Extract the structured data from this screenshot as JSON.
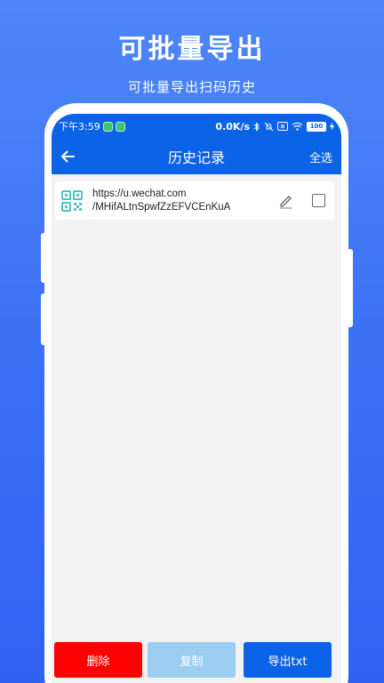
{
  "promo": {
    "title": "可批量导出",
    "subtitle": "可批量导出扫码历史"
  },
  "status_bar": {
    "time": "下午3:59",
    "network_speed": "0.0K/s",
    "battery": "100"
  },
  "app_bar": {
    "title": "历史记录",
    "select_all": "全选"
  },
  "history": {
    "items": [
      {
        "line1": "https://u.wechat.com",
        "line2": "/MHifALtnSpwfZzEFVCEnKuA",
        "checked": false
      }
    ]
  },
  "actions": {
    "delete": "删除",
    "copy": "复制",
    "export": "导出txt"
  },
  "colors": {
    "primary": "#0b63e8",
    "delete": "#ff0000",
    "copy_disabled": "#9ccdf0",
    "qr_icon": "#4fc3c8"
  },
  "icons": {
    "back": "arrow-left-icon",
    "qr": "qr-code-icon",
    "edit": "pencil-icon",
    "bluetooth": "bluetooth-icon",
    "mute": "mute-icon",
    "wifi": "wifi-icon"
  }
}
